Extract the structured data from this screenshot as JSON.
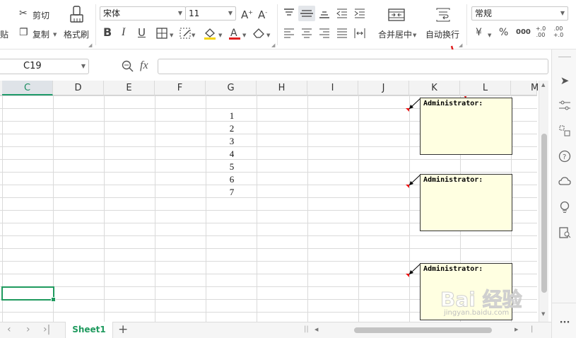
{
  "ribbon": {
    "paste": "贴",
    "cut": "剪切",
    "copy": "复制",
    "format_painter": "格式刷",
    "font_name": "宋体",
    "font_size": "11",
    "merge_center": "合并居中",
    "wrap_text": "自动换行",
    "number_format": "常规",
    "currency_symbol": "¥",
    "percent_symbol": "%",
    "thousands": "000",
    "dec_inc": "+.0 .00",
    "dec_dec": ".00 +.0"
  },
  "formula_bar": {
    "name_box": "C19",
    "fx": "fx",
    "value": ""
  },
  "columns": [
    "C",
    "D",
    "E",
    "F",
    "G",
    "H",
    "I",
    "J",
    "K",
    "L",
    "M"
  ],
  "selected_column": "C",
  "cells_G": [
    "1",
    "2",
    "3",
    "4",
    "5",
    "6",
    "7"
  ],
  "comments": [
    {
      "author": "Administrator:"
    },
    {
      "author": "Administrator:"
    },
    {
      "author": "Administrator:"
    }
  ],
  "sheets": [
    "Sheet1"
  ],
  "add_sheet": "+",
  "more": "···",
  "watermark": "Bai 经验",
  "watermark_sub": "jingyan.baidu.com",
  "colors": {
    "accent_green": "#1f9a5e",
    "arrow_red": "#e02020",
    "comment_bg": "#ffffe1"
  }
}
